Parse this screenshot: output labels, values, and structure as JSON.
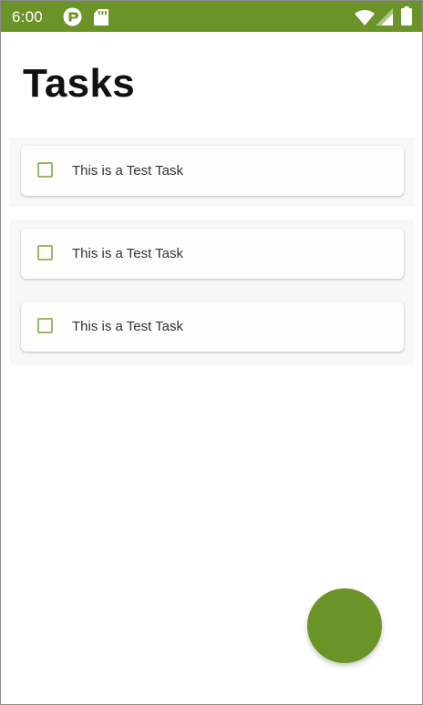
{
  "status_bar": {
    "time": "6:00",
    "icons": [
      "app-notification-icon",
      "sd-card-icon",
      "wifi-icon",
      "signal-icon",
      "battery-icon"
    ]
  },
  "page": {
    "title": "Tasks"
  },
  "groups": [
    {
      "tasks": [
        {
          "label": "This is a Test Task",
          "checked": false
        }
      ]
    },
    {
      "tasks": [
        {
          "label": "This is a Test Task",
          "checked": false
        },
        {
          "label": "This is a Test Task",
          "checked": false
        }
      ]
    }
  ],
  "fab": {
    "icon": "add-icon"
  },
  "colors": {
    "primary": "#6b9428",
    "checkbox_border": "#9bb86a",
    "group_background": "#f8f9f7"
  }
}
